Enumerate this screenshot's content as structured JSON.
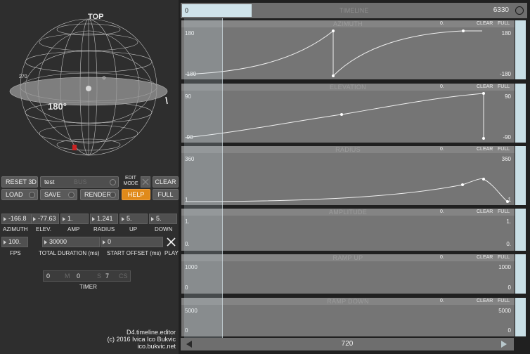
{
  "sphere": {
    "top_label": "TOP",
    "angle_label": "180°",
    "tick_labels": [
      "270",
      "0",
      "90"
    ]
  },
  "buttons": {
    "reset3d": "RESET 3D",
    "bus_name": "test",
    "bus_placeholder": "BUS",
    "edit_mode": "EDIT MODE",
    "clear": "CLEAR",
    "load": "LOAD",
    "save": "SAVE",
    "render": "RENDER",
    "help": "HELP",
    "full": "FULL"
  },
  "params": [
    {
      "label": "AZIMUTH",
      "value": "-166.8"
    },
    {
      "label": "ELEV.",
      "value": "-77.63"
    },
    {
      "label": "AMP",
      "value": "1."
    },
    {
      "label": "RADIUS",
      "value": "1.241"
    },
    {
      "label": "UP",
      "value": "5."
    },
    {
      "label": "DOWN",
      "value": "5."
    }
  ],
  "transport": {
    "fps_value": "100.",
    "fps_label": "FPS",
    "duration_value": "30000",
    "duration_label": "TOTAL DURATION (ms)",
    "offset_value": "0",
    "offset_label": "START OFFSET (ms)",
    "play_label": "PLAY"
  },
  "timer": {
    "m_value": "0",
    "m_unit": "M",
    "s_value": "0",
    "s_unit": "S",
    "cs_value": "7",
    "cs_unit": "CS",
    "label": "TIMER"
  },
  "credits": {
    "line1": "D4.timeline.editor",
    "line2": "(c) 2016  Ivica Ico Bukvic",
    "line3": "ico.bukvic.net"
  },
  "timeline": {
    "header": "TIMELINE",
    "position": "0",
    "end": "6330",
    "footer_value": "720"
  },
  "tracks": [
    {
      "name": "AZIMUTH",
      "value": "0.",
      "clear": "CLEAR",
      "full": "FULL",
      "max": "180",
      "min": "-180",
      "min_right": "-180"
    },
    {
      "name": "ELEVATION",
      "value": "0.",
      "clear": "CLEAR",
      "full": "FULL",
      "max": "90",
      "min": "-90",
      "min_right": "-90"
    },
    {
      "name": "RADIUS",
      "value": "0.",
      "clear": "CLEAR",
      "full": "FULL",
      "max": "360",
      "min": "1",
      "min_right": "1"
    },
    {
      "name": "AMPLITUDE",
      "value": "0.",
      "clear": "CLEAR",
      "full": "FULL",
      "max": "1.",
      "min": "0.",
      "min_right": "0."
    },
    {
      "name": "RAMP UP",
      "value": "0.",
      "clear": "CLEAR",
      "full": "FULL",
      "max": "1000",
      "min": "0",
      "min_right": "0"
    },
    {
      "name": "RAMP DOWN",
      "value": "0.",
      "clear": "CLEAR",
      "full": "FULL",
      "max": "5000",
      "min": "0",
      "min_right": "0"
    }
  ],
  "colors": {
    "accent_orange": "#e08a1a",
    "playhead_blue": "#c9dfe6",
    "marker_red": "#cc2222"
  }
}
